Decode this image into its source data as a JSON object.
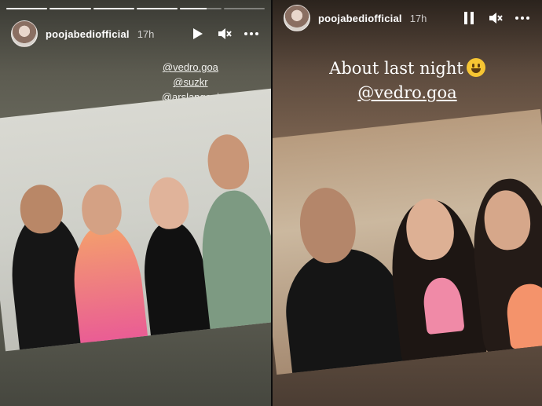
{
  "left_story": {
    "progress": [
      1,
      1,
      1,
      1,
      0.65,
      0
    ],
    "account": {
      "username": "poojabediofficial",
      "time": "17h"
    },
    "controls": [
      "play-icon",
      "mute-icon",
      "more-icon"
    ],
    "mentions": [
      "@vedro.goa",
      "@suzkr",
      "@arslangoni"
    ]
  },
  "right_story": {
    "account": {
      "username": "poojabediofficial",
      "time": "17h"
    },
    "controls": [
      "pause-icon",
      "mute-icon",
      "more-icon"
    ],
    "caption": {
      "line1": "About last night",
      "emoji": "grinning-face",
      "line2": "@vedro.goa"
    }
  }
}
